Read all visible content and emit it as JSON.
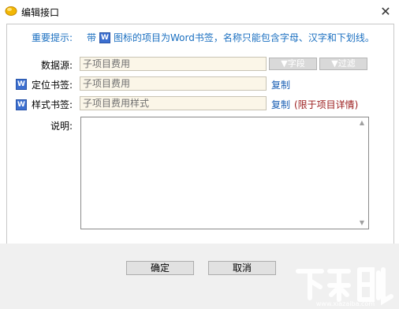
{
  "window": {
    "title": "编辑接口",
    "close_glyph": "✕"
  },
  "hint": {
    "label": "重要提示:",
    "prefix": "带",
    "icon_letter": "W",
    "text": "图标的项目为Word书签，名称只能包含字母、汉字和下划线。"
  },
  "fields": {
    "data_source": {
      "label": "数据源:",
      "value": "子项目费用",
      "field_button": "▼字段",
      "filter_button": "▼过滤"
    },
    "locate_bookmark": {
      "icon_letter": "W",
      "label": "定位书签:",
      "value": "子项目费用",
      "copy_label": "复制"
    },
    "style_bookmark": {
      "icon_letter": "W",
      "label": "样式书签:",
      "value": "子项目费用样式",
      "copy_label": "复制",
      "note": "(限于项目详情)"
    },
    "description": {
      "label": "说明:",
      "value": ""
    }
  },
  "buttons": {
    "ok": "确定",
    "cancel": "取消"
  },
  "watermark": {
    "text": "下载吧",
    "url": "www.xiazaiba.com"
  },
  "colors": {
    "hint": "#1a6fc0",
    "link": "#1a5fb4",
    "note": "#9a1a1a",
    "field_bg": "#fbf6e8",
    "footer_bg": "#f0f0f0"
  }
}
